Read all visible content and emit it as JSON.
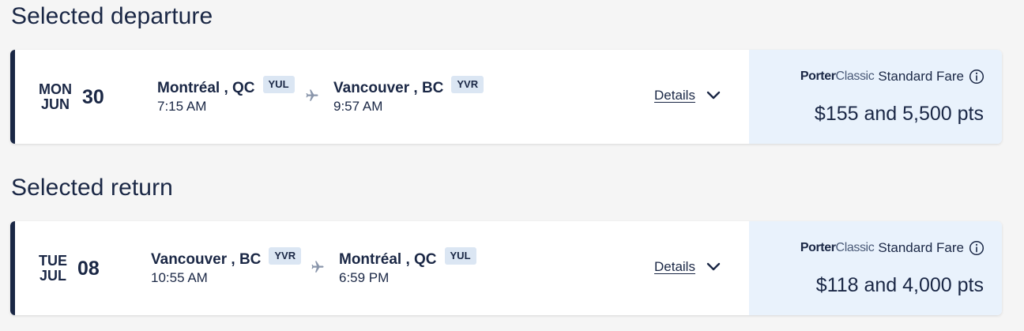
{
  "departure": {
    "section_title": "Selected departure",
    "weekday": "MON",
    "month": "JUN",
    "day": "30",
    "origin": {
      "city": "Montréal , QC",
      "code": "YUL",
      "time": "7:15 AM"
    },
    "destination": {
      "city": "Vancouver , BC",
      "code": "YVR",
      "time": "9:57 AM"
    },
    "details_label": "Details",
    "fare_brand_bold": "Porter",
    "fare_brand_light": "Classic",
    "fare_name": "Standard Fare",
    "price": "$155 and 5,500 pts"
  },
  "return": {
    "section_title": "Selected return",
    "weekday": "TUE",
    "month": "JUL",
    "day": "08",
    "origin": {
      "city": "Vancouver , BC",
      "code": "YVR",
      "time": "10:55 AM"
    },
    "destination": {
      "city": "Montréal , QC",
      "code": "YUL",
      "time": "6:59 PM"
    },
    "details_label": "Details",
    "fare_brand_bold": "Porter",
    "fare_brand_light": "Classic",
    "fare_name": "Standard Fare",
    "price": "$118 and 4,000 pts"
  },
  "icons": {
    "plane": "plane-icon",
    "chevron": "chevron-down-icon",
    "info": "info-icon"
  },
  "colors": {
    "navy": "#1a2745",
    "fare_bg": "#e9f2fc",
    "code_bg": "#dbe6f3",
    "page_bg": "#f5f5f5"
  }
}
